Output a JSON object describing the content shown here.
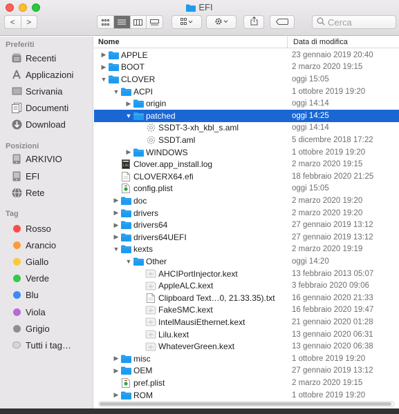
{
  "window": {
    "title": "EFI"
  },
  "toolbar": {
    "back": "<",
    "forward": ">",
    "search_placeholder": "Cerca"
  },
  "sidebar": {
    "sections": [
      {
        "label": "Preferiti"
      },
      {
        "label": "Posizioni"
      },
      {
        "label": "Tag"
      }
    ],
    "favorites": [
      "Recenti",
      "Applicazioni",
      "Scrivania",
      "Documenti",
      "Download"
    ],
    "locations": [
      "ARKIVIO",
      "EFI",
      "Rete"
    ],
    "tags": [
      {
        "label": "Rosso",
        "color": "#fd4c47"
      },
      {
        "label": "Arancio",
        "color": "#fd9a3a"
      },
      {
        "label": "Giallo",
        "color": "#fcc93a"
      },
      {
        "label": "Verde",
        "color": "#34c94a"
      },
      {
        "label": "Blu",
        "color": "#3a88fc"
      },
      {
        "label": "Viola",
        "color": "#b86ad8"
      },
      {
        "label": "Grigio",
        "color": "#8e8e93"
      },
      {
        "label": "Tutti i tag…",
        "color": ""
      }
    ]
  },
  "columns": {
    "name": "Nome",
    "date": "Data di modifica"
  },
  "rows": [
    {
      "name": "APPLE",
      "date": "23 gennaio 2019 20:40",
      "level": 0,
      "type": "folder",
      "expanded": false
    },
    {
      "name": "BOOT",
      "date": "2 marzo 2020 19:15",
      "level": 0,
      "type": "folder",
      "expanded": false
    },
    {
      "name": "CLOVER",
      "date": "oggi 15:05",
      "level": 0,
      "type": "folder",
      "expanded": true
    },
    {
      "name": "ACPI",
      "date": "1 ottobre 2019 19:20",
      "level": 1,
      "type": "folder",
      "expanded": true
    },
    {
      "name": "origin",
      "date": "oggi 14:14",
      "level": 2,
      "type": "folder",
      "expanded": false
    },
    {
      "name": "patched",
      "date": "oggi 14:25",
      "level": 2,
      "type": "folder",
      "expanded": true,
      "selected": true
    },
    {
      "name": "SSDT-3-xh_kbl_s.aml",
      "date": "oggi 14:14",
      "level": 3,
      "type": "aml"
    },
    {
      "name": "SSDT.aml",
      "date": "5 dicembre 2018 17:22",
      "level": 3,
      "type": "aml"
    },
    {
      "name": "WINDOWS",
      "date": "1 ottobre 2019 19:20",
      "level": 2,
      "type": "folder",
      "expanded": false
    },
    {
      "name": "Clover.app_install.log",
      "date": "2 marzo 2020 19:15",
      "level": 1,
      "type": "log"
    },
    {
      "name": "CLOVERX64.efi",
      "date": "18 febbraio 2020 21:25",
      "level": 1,
      "type": "doc"
    },
    {
      "name": "config.plist",
      "date": "oggi 15:05",
      "level": 1,
      "type": "plist"
    },
    {
      "name": "doc",
      "date": "2 marzo 2020 19:20",
      "level": 1,
      "type": "folder",
      "expanded": false
    },
    {
      "name": "drivers",
      "date": "2 marzo 2020 19:20",
      "level": 1,
      "type": "folder",
      "expanded": false
    },
    {
      "name": "drivers64",
      "date": "27 gennaio 2019 13:12",
      "level": 1,
      "type": "folder",
      "expanded": false
    },
    {
      "name": "drivers64UEFI",
      "date": "27 gennaio 2019 13:12",
      "level": 1,
      "type": "folder",
      "expanded": false
    },
    {
      "name": "kexts",
      "date": "2 marzo 2020 19:19",
      "level": 1,
      "type": "folder",
      "expanded": true
    },
    {
      "name": "Other",
      "date": "oggi 14:20",
      "level": 2,
      "type": "folder",
      "expanded": true
    },
    {
      "name": "AHCIPortInjector.kext",
      "date": "13 febbraio 2013 05:07",
      "level": 3,
      "type": "kext"
    },
    {
      "name": "AppleALC.kext",
      "date": "3 febbraio 2020 09:06",
      "level": 3,
      "type": "kext"
    },
    {
      "name": "Clipboard Text…0, 21.33.35).txt",
      "date": "16 gennaio 2020 21:33",
      "level": 3,
      "type": "doc"
    },
    {
      "name": "FakeSMC.kext",
      "date": "16 febbraio 2020 19:47",
      "level": 3,
      "type": "kext"
    },
    {
      "name": "IntelMausiEthernet.kext",
      "date": "21 gennaio 2020 01:28",
      "level": 3,
      "type": "kext"
    },
    {
      "name": "Lilu.kext",
      "date": "13 gennaio 2020 06:31",
      "level": 3,
      "type": "kext"
    },
    {
      "name": "WhateverGreen.kext",
      "date": "13 gennaio 2020 06:38",
      "level": 3,
      "type": "kext"
    },
    {
      "name": "misc",
      "date": "1 ottobre 2019 19:20",
      "level": 1,
      "type": "folder",
      "expanded": false
    },
    {
      "name": "OEM",
      "date": "27 gennaio 2019 13:12",
      "level": 1,
      "type": "folder",
      "expanded": false
    },
    {
      "name": "pref.plist",
      "date": "2 marzo 2020 19:15",
      "level": 1,
      "type": "plist"
    },
    {
      "name": "ROM",
      "date": "1 ottobre 2019 19:20",
      "level": 1,
      "type": "folder",
      "expanded": false
    }
  ],
  "colors": {
    "selection": "#1a67d4",
    "folder": "#1e9bf0"
  }
}
